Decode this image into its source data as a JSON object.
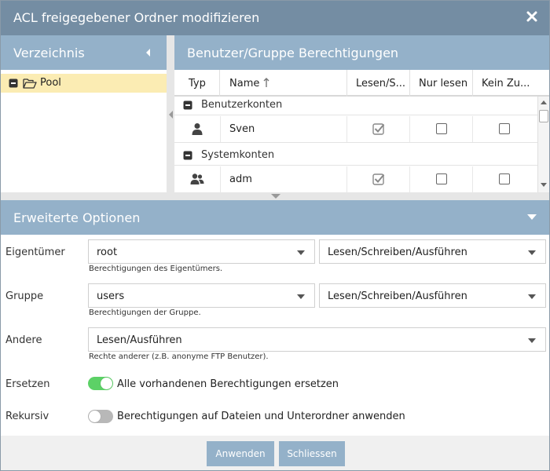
{
  "dialog": {
    "title": "ACL freigegebener Ordner modifizieren",
    "close_icon": "close-icon"
  },
  "left_panel": {
    "header": "Verzeichnis",
    "collapse_icon": "caret-left-icon",
    "tree": [
      {
        "label": "Pool",
        "expand_icon": "minus-box-icon",
        "icon": "folder-open-icon",
        "selected": true
      }
    ]
  },
  "right_panel": {
    "header": "Benutzer/Gruppe Berechtigungen",
    "columns": [
      "Typ",
      "Name",
      "Lesen/S...",
      "Nur lesen",
      "Kein Zu..."
    ],
    "sort_icon": "sort-ascending-icon",
    "groups": [
      {
        "label": "Benutzerkonten",
        "rows": [
          {
            "type_icon": "user-icon",
            "name": "Sven",
            "read_write": true,
            "read_only": false,
            "no_access": false
          }
        ]
      },
      {
        "label": "Systemkonten",
        "rows": [
          {
            "type_icon": "users-icon",
            "name": "adm",
            "read_write": true,
            "read_only": false,
            "no_access": false
          }
        ]
      }
    ]
  },
  "advanced": {
    "header": "Erweiterte Optionen",
    "owner": {
      "label": "Eigentümer",
      "value": "root",
      "permission": "Lesen/Schreiben/Ausführen",
      "hint": "Berechtigungen des Eigentümers."
    },
    "group": {
      "label": "Gruppe",
      "value": "users",
      "permission": "Lesen/Schreiben/Ausführen",
      "hint": "Berechtigungen der Gruppe."
    },
    "others": {
      "label": "Andere",
      "permission": "Lesen/Ausführen",
      "hint": "Rechte anderer (z.B. anonyme FTP Benutzer)."
    },
    "replace": {
      "label": "Ersetzen",
      "toggle_label": "Alle vorhandenen Berechtigungen ersetzen",
      "enabled": true
    },
    "recursive": {
      "label": "Rekursiv",
      "toggle_label": "Berechtigungen auf Dateien und Unterordner anwenden",
      "enabled": false
    }
  },
  "footer": {
    "apply_label": "Anwenden",
    "close_label": "Schliessen"
  },
  "colors": {
    "titlebar": "#748da3",
    "panel_header": "#94b1c9",
    "selection": "#fbecb3",
    "toggle_on": "#5cd166",
    "toggle_off": "#b8b8b8"
  }
}
